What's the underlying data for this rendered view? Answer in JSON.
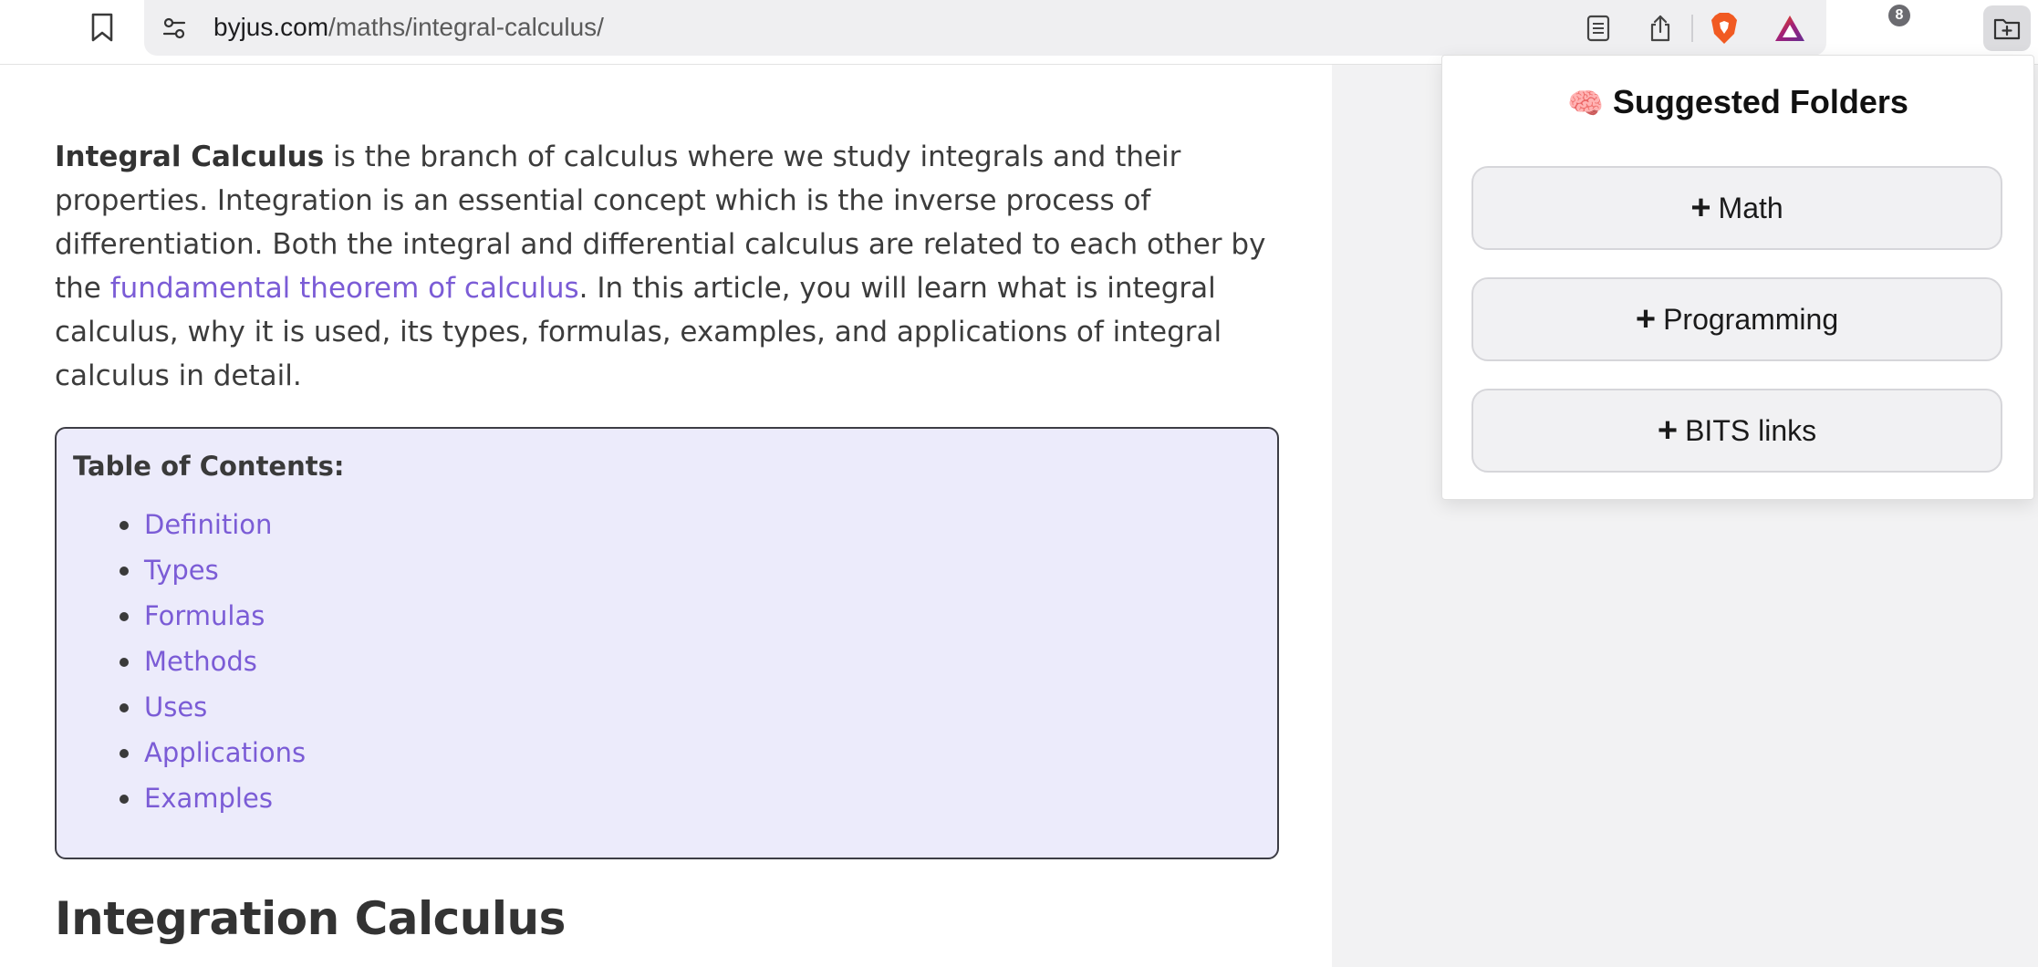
{
  "browser": {
    "url_domain": "byjus.com",
    "url_path": "/maths/integral-calculus/",
    "brave_shields_count": "8"
  },
  "article": {
    "intro_bold": "Integral Calculus",
    "intro_part1": " is the branch of calculus where we study integrals and their properties. Integration is an essential concept which is the inverse process of differentiation. Both the integral and differential calculus are related to each other by the ",
    "intro_link": "fundamental theorem of calculus",
    "intro_part2": ". In this article, you will learn what is integral calculus, why it is used, its types, formulas, examples, and applications of integral calculus in detail.",
    "toc_title": "Table of Contents:",
    "toc_items": [
      {
        "label": "Definition"
      },
      {
        "label": "Types"
      },
      {
        "label": "Formulas"
      },
      {
        "label": "Methods"
      },
      {
        "label": "Uses"
      },
      {
        "label": "Applications"
      },
      {
        "label": "Examples"
      }
    ],
    "section_heading": "Integration Calculus"
  },
  "popup": {
    "title_emoji": "🧠",
    "title": "Suggested Folders",
    "folders": [
      {
        "label": "Math"
      },
      {
        "label": "Programming"
      },
      {
        "label": "BITS links"
      }
    ]
  },
  "colors": {
    "link": "#7b5cd6",
    "toc_background": "#ecebfb",
    "brave_orange": "#f15a22"
  }
}
